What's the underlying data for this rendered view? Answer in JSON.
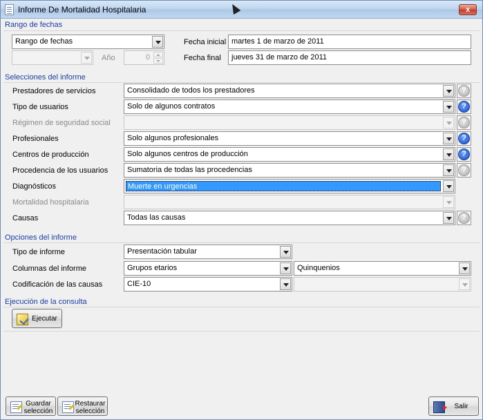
{
  "window": {
    "title": "Informe De Mortalidad Hospitalaria",
    "close_glyph": "x"
  },
  "rango": {
    "section_title": "Rango de fechas",
    "tipo_rango": "Rango de fechas",
    "anio_label": "Año",
    "anio_value": "0",
    "fecha_inicial_label": "Fecha inicial",
    "fecha_inicial_value": "martes 1 de marzo de 2011",
    "fecha_final_label": "Fecha final",
    "fecha_final_value": "jueves 31 de marzo de 2011"
  },
  "selecciones": {
    "section_title": "Selecciones del informe",
    "rows": [
      {
        "label": "Prestadores de servicios",
        "value": "Consolidado de todos los prestadores",
        "enabled": true,
        "help": "off"
      },
      {
        "label": "Tipo de usuarios",
        "value": "Solo de algunos contratos",
        "enabled": true,
        "help": "on"
      },
      {
        "label": "Régimen de seguridad social",
        "value": "",
        "enabled": false,
        "help": "off"
      },
      {
        "label": "Profesionales",
        "value": "Solo algunos profesionales",
        "enabled": true,
        "help": "on"
      },
      {
        "label": "Centros de producción",
        "value": "Solo algunos centros de producción",
        "enabled": true,
        "help": "on"
      },
      {
        "label": "Procedencia de los usuarios",
        "value": "Sumatoria de todas las procedencias",
        "enabled": true,
        "help": "off"
      },
      {
        "label": "Diagnósticos",
        "value": "Muerte en urgencias",
        "enabled": true,
        "help": "none",
        "selected": true
      },
      {
        "label": "Mortalidad hospitalaria",
        "value": "",
        "enabled": false,
        "help": "none"
      },
      {
        "label": "Causas",
        "value": "Todas las causas",
        "enabled": true,
        "help": "off"
      }
    ],
    "help_glyph": "?"
  },
  "opciones": {
    "section_title": "Opciones del informe",
    "tipo_informe_label": "Tipo de informe",
    "tipo_informe_value": "Presentación tabular",
    "columnas_label": "Columnas del informe",
    "columnas_value": "Grupos etarios",
    "columnas_value2": "Quinquenios",
    "codificacion_label": "Codificación de las causas",
    "codificacion_value": "CIE-10",
    "codificacion_value2": ""
  },
  "ejecucion": {
    "section_title": "Ejecución de la consulta",
    "ejecutar_label": "Ejecutar"
  },
  "footer": {
    "guardar_line1": "Guardar",
    "guardar_line2": "selección",
    "restaurar_line1": "Restaurar",
    "restaurar_line2": "selección",
    "salir_label": "Salir"
  }
}
